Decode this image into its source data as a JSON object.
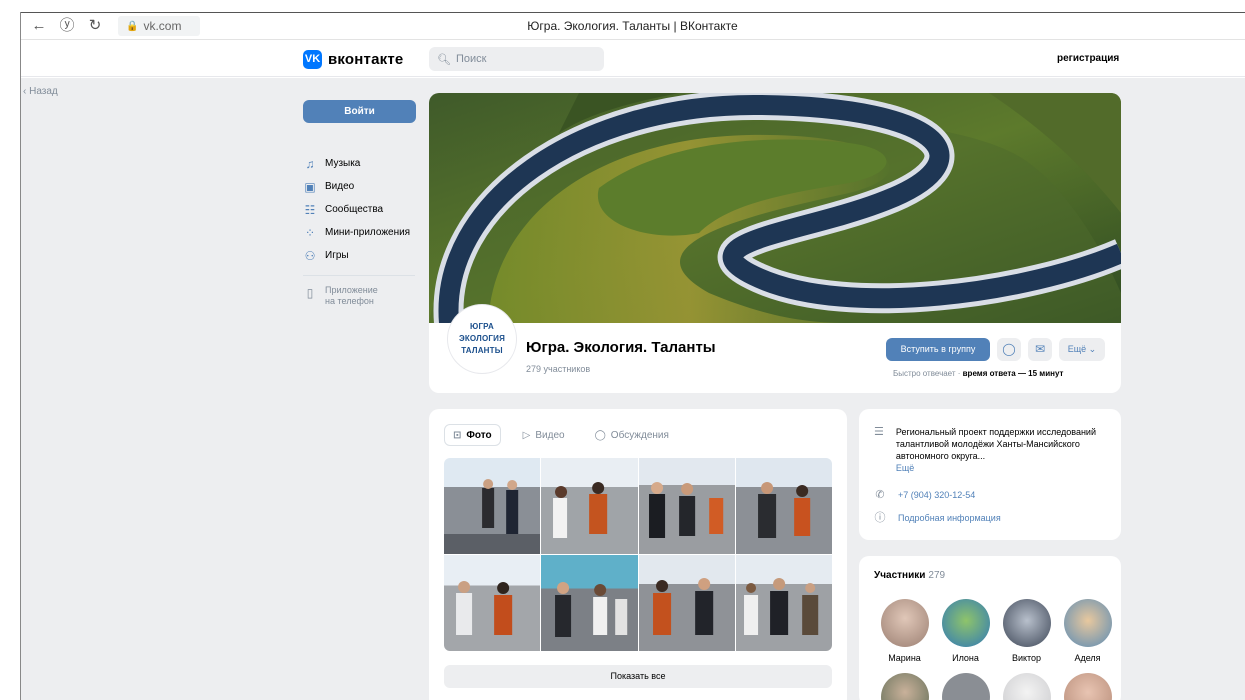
{
  "browser": {
    "address": "vk.com",
    "tab_title": "Югра. Экология. Таланты | ВКонтакте"
  },
  "header": {
    "logo_text": "вконтакте",
    "logo_mark": "VK",
    "search_placeholder": "Поиск",
    "register_label": "регистрация"
  },
  "back_label": "Назад",
  "sidebar": {
    "login_label": "Войти",
    "items": [
      {
        "label": "Музыка",
        "icon": "music-icon"
      },
      {
        "label": "Видео",
        "icon": "video-icon"
      },
      {
        "label": "Сообщества",
        "icon": "communities-icon"
      },
      {
        "label": "Мини-приложения",
        "icon": "mini-apps-icon"
      },
      {
        "label": "Игры",
        "icon": "games-icon"
      }
    ],
    "app_line1": "Приложение",
    "app_line2": "на телефон"
  },
  "group": {
    "avatar_lines": [
      "ЮГРА",
      "ЭКОЛОГИЯ",
      "ТАЛАНТЫ"
    ],
    "name": "Югра. Экология. Таланты",
    "members": "279 участников",
    "join_label": "Вступить в группу",
    "more_label": "Ещё ⌄",
    "reply_prefix": "Быстро отвечает · ",
    "reply_time": "время ответа — 15 минут"
  },
  "media": {
    "tabs": [
      {
        "label": "Фото",
        "active": true
      },
      {
        "label": "Видео",
        "active": false
      },
      {
        "label": "Обсуждения",
        "active": false
      }
    ],
    "show_all_label": "Показать все"
  },
  "info": {
    "description": "Региональный проект поддержки исследований талантливой молодёжи Ханты-Мансийского автономного округа...",
    "description_more": "Ещё",
    "phone": "+7 (904) 320-12-54",
    "details_label": "Подробная информация"
  },
  "members_block": {
    "title": "Участники",
    "count": "279",
    "people": [
      {
        "name": "Марина",
        "color": "#b89a8a"
      },
      {
        "name": "Илона",
        "color": "#4f8fc9"
      },
      {
        "name": "Виктор",
        "color": "#6f7b8f"
      },
      {
        "name": "Аделя",
        "color": "#c9a47a"
      }
    ]
  },
  "colors": {
    "accent": "#5181b8",
    "vk_blue": "#0077ff",
    "page_bg": "#edeef0"
  }
}
